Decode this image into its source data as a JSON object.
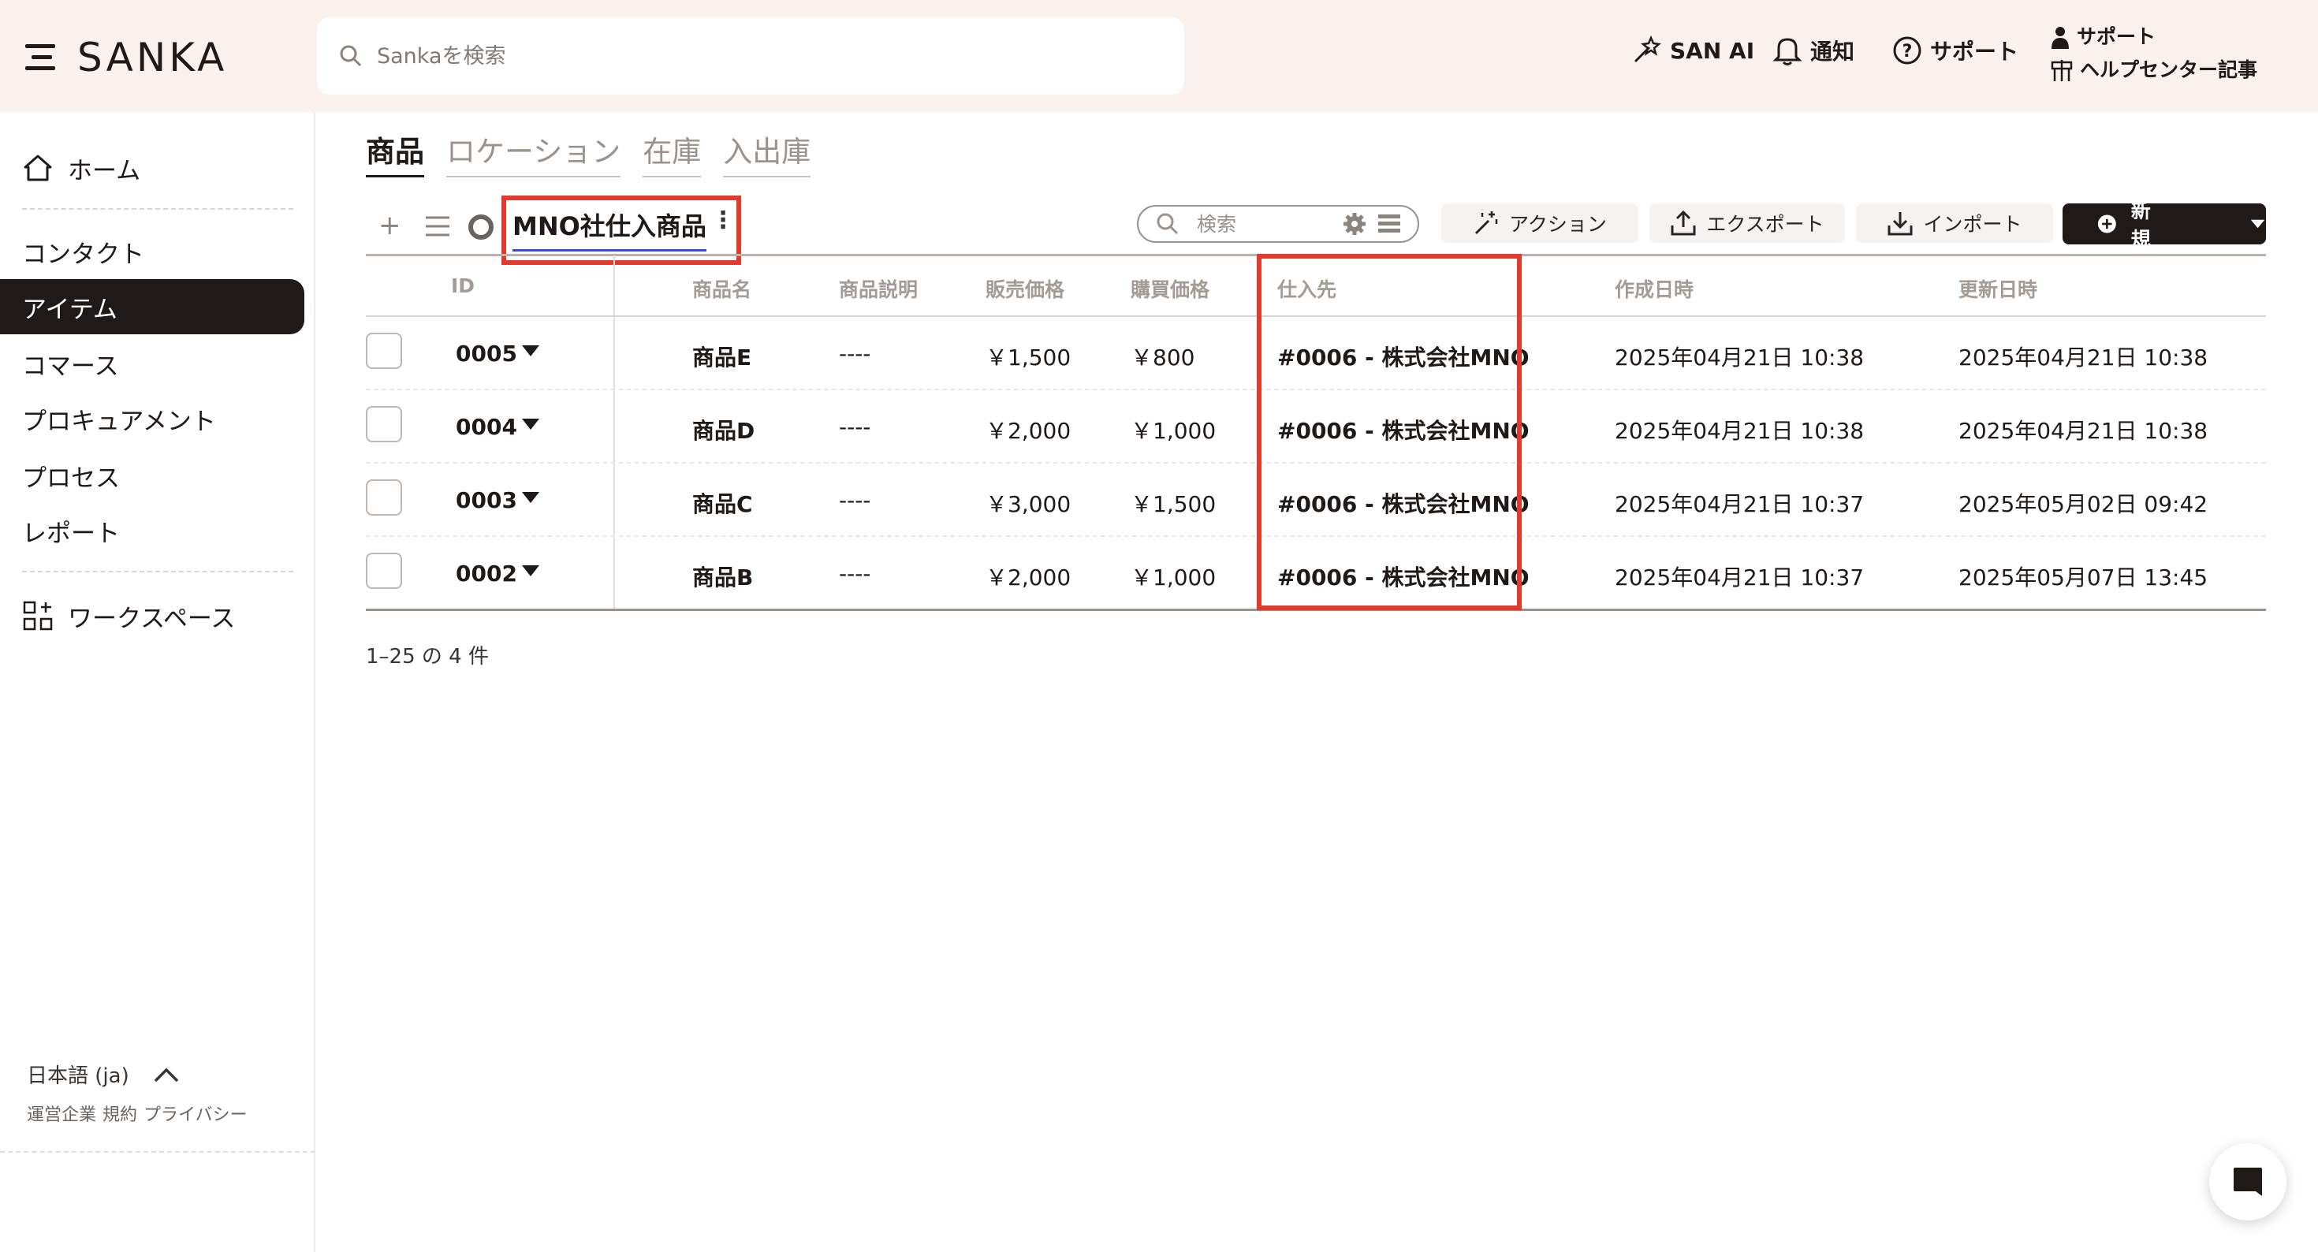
{
  "header": {
    "logo_text": "SANKA",
    "search_placeholder": "Sankaを検索",
    "san_ai": "SAN AI",
    "notifications": "通知",
    "support": "サポート",
    "support_small": "サポート",
    "help_center": "ヘルプセンター記事"
  },
  "sidebar": {
    "home": "ホーム",
    "items": [
      "コンタクト",
      "アイテム",
      "コマース",
      "プロキュアメント",
      "プロセス",
      "レポート"
    ],
    "active_index": 1,
    "workspace": "ワークスペース",
    "language": "日本語 (ja)",
    "footer_links": [
      "運営企業",
      "規約",
      "プライバシー"
    ]
  },
  "tabs": [
    "商品",
    "ロケーション",
    "在庫",
    "入出庫"
  ],
  "active_tab": 0,
  "view": {
    "name": "MNO社仕入商品",
    "search_placeholder": "検索"
  },
  "toolbar": {
    "action": "アクション",
    "export": "エクスポート",
    "import": "インポート",
    "new": "新規"
  },
  "table": {
    "columns": [
      "ID",
      "商品名",
      "商品説明",
      "販売価格",
      "購買価格",
      "仕入先",
      "作成日時",
      "更新日時"
    ],
    "rows": [
      {
        "id": "0005",
        "name": "商品E",
        "desc": "----",
        "sale": "￥1,500",
        "purchase": "￥800",
        "supplier": "#0006 - 株式会社MNO",
        "created": "2025年04月21日 10:38",
        "updated": "2025年04月21日 10:38"
      },
      {
        "id": "0004",
        "name": "商品D",
        "desc": "----",
        "sale": "￥2,000",
        "purchase": "￥1,000",
        "supplier": "#0006 - 株式会社MNO",
        "created": "2025年04月21日 10:38",
        "updated": "2025年04月21日 10:38"
      },
      {
        "id": "0003",
        "name": "商品C",
        "desc": "----",
        "sale": "￥3,000",
        "purchase": "￥1,500",
        "supplier": "#0006 - 株式会社MNO",
        "created": "2025年04月21日 10:37",
        "updated": "2025年05月02日 09:42"
      },
      {
        "id": "0002",
        "name": "商品B",
        "desc": "----",
        "sale": "￥2,000",
        "purchase": "￥1,000",
        "supplier": "#0006 - 株式会社MNO",
        "created": "2025年04月21日 10:37",
        "updated": "2025年05月07日 13:45"
      }
    ],
    "pagination": "1–25 の 4 件"
  },
  "colors": {
    "highlight": "#e23b2e",
    "active_underline": "#3b4bd8",
    "dark": "#1f1a17",
    "header_bg": "#fbf1ec"
  }
}
